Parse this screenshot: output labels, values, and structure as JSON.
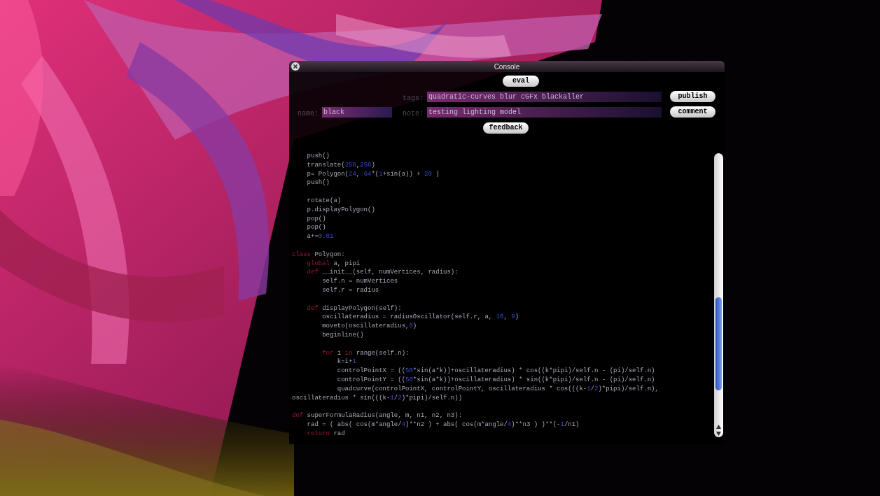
{
  "window": {
    "title": "Console"
  },
  "buttons": {
    "eval": "eval",
    "publish": "publish",
    "comment": "comment",
    "feedback": "feedback"
  },
  "fields": {
    "tags": {
      "label": "tags:",
      "value": "quadratic-curves blur cGFx blackaller"
    },
    "name": {
      "label": "name:",
      "value": "black"
    },
    "note": {
      "label": "note:",
      "value": "testing lighting model"
    }
  },
  "code_lines": [
    {
      "kind": "code",
      "segments": [
        "    push()"
      ]
    },
    {
      "kind": "code",
      "segments": [
        "    translate(",
        {
          "kind": "number",
          "text": "256"
        },
        ",",
        {
          "kind": "number",
          "text": "256"
        },
        ")"
      ]
    },
    {
      "kind": "code",
      "segments": [
        "    p= Polygon(",
        {
          "kind": "number",
          "text": "24"
        },
        ", ",
        {
          "kind": "number",
          "text": "64"
        },
        "*(",
        {
          "kind": "number",
          "text": "1"
        },
        "+sin(a)) + ",
        {
          "kind": "number",
          "text": "20"
        },
        " )"
      ]
    },
    {
      "kind": "code",
      "segments": [
        "    push()"
      ]
    },
    {
      "kind": "blank"
    },
    {
      "kind": "code",
      "segments": [
        "    rotate(a)"
      ]
    },
    {
      "kind": "code",
      "segments": [
        "    p.displayPolygon()"
      ]
    },
    {
      "kind": "code",
      "segments": [
        "    pop()"
      ]
    },
    {
      "kind": "code",
      "segments": [
        "    pop()"
      ]
    },
    {
      "kind": "code",
      "segments": [
        "    a+=",
        {
          "kind": "number",
          "text": "0.01"
        }
      ]
    },
    {
      "kind": "blank"
    },
    {
      "kind": "code",
      "segments": [
        {
          "kind": "keyword",
          "text": "class"
        },
        " Polygon:"
      ]
    },
    {
      "kind": "code",
      "segments": [
        {
          "kind": "keyword",
          "text": "    global"
        },
        " a, pipi"
      ]
    },
    {
      "kind": "code",
      "segments": [
        {
          "kind": "keyword",
          "text": "    def"
        },
        " __init__(self, numVertices, radius):"
      ]
    },
    {
      "kind": "code",
      "segments": [
        "        self.n = numVertices"
      ]
    },
    {
      "kind": "code",
      "segments": [
        "        self.r = radius"
      ]
    },
    {
      "kind": "blank"
    },
    {
      "kind": "code",
      "segments": [
        {
          "kind": "keyword",
          "text": "    def"
        },
        " displayPolygon(self):"
      ]
    },
    {
      "kind": "code",
      "segments": [
        "        oscillateradius = radiusOscillator(self.r, a, ",
        {
          "kind": "number",
          "text": "10"
        },
        ", ",
        {
          "kind": "number",
          "text": "9"
        },
        ")"
      ]
    },
    {
      "kind": "code",
      "segments": [
        "        moveto(oscillateradius,",
        {
          "kind": "number",
          "text": "0"
        },
        ")"
      ]
    },
    {
      "kind": "code",
      "segments": [
        "        beginline()"
      ]
    },
    {
      "kind": "blank"
    },
    {
      "kind": "code",
      "segments": [
        {
          "kind": "keyword",
          "text": "        for"
        },
        " i ",
        {
          "kind": "keyword",
          "text": "in"
        },
        " range(self.n):"
      ]
    },
    {
      "kind": "code",
      "segments": [
        "            k=i+",
        {
          "kind": "number",
          "text": "1"
        }
      ]
    },
    {
      "kind": "code",
      "segments": [
        "            controlPointX = ((",
        {
          "kind": "number",
          "text": "50"
        },
        "*sin(a*k))+oscillateradius) * cos((k*pipi)/self.n - (pi)/self.n)"
      ]
    },
    {
      "kind": "code",
      "segments": [
        "            controlPointY = ((",
        {
          "kind": "number",
          "text": "50"
        },
        "*sin(a*k))+oscillateradius) * sin((k*pipi)/self.n - (pi)/self.n)"
      ]
    },
    {
      "kind": "code",
      "segments": [
        "            quadcurve(controlPointX, controlPointY, oscillateradius * cos(((k-",
        {
          "kind": "number",
          "text": "1"
        },
        "/",
        {
          "kind": "number",
          "text": "2"
        },
        ")*pipi)/self.n),"
      ]
    },
    {
      "kind": "code",
      "segments": [
        "oscillateradius * sin(((k-",
        {
          "kind": "number",
          "text": "1"
        },
        "/",
        {
          "kind": "number",
          "text": "2"
        },
        ")*pipi)/self.n))"
      ]
    },
    {
      "kind": "blank"
    },
    {
      "kind": "code",
      "segments": [
        {
          "kind": "keyword",
          "text": "def"
        },
        " superFormulaRadius(angle, m, n1, n2, n3):"
      ]
    },
    {
      "kind": "code",
      "segments": [
        "    rad = ( abs( cos(m*angle/",
        {
          "kind": "number",
          "text": "4"
        },
        ")**n2 ) + abs( cos(m*angle/",
        {
          "kind": "number",
          "text": "4"
        },
        ")**n3 ) )**(-",
        {
          "kind": "number",
          "text": "1"
        },
        "/n1)"
      ]
    },
    {
      "kind": "code",
      "segments": [
        {
          "kind": "keyword",
          "text": "    return"
        },
        " rad"
      ]
    }
  ]
}
